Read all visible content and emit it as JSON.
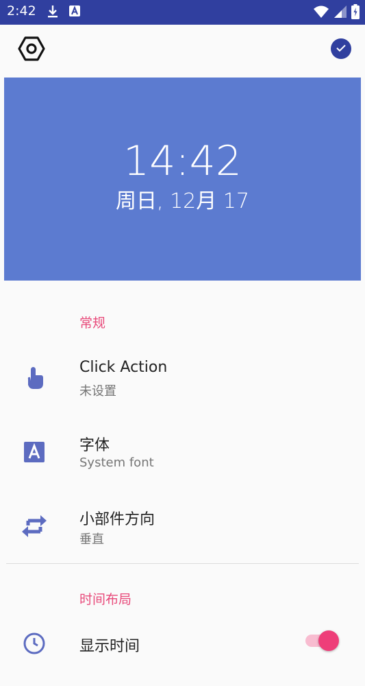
{
  "status_bar": {
    "time": "2:42",
    "left_icons": [
      "download-icon",
      "font-app-icon"
    ],
    "right_icons": [
      "wifi-icon",
      "signal-icon",
      "battery-icon"
    ],
    "bg_color": "#303f9f"
  },
  "toolbar": {
    "settings_icon": "settings-hexagon-icon",
    "confirm_icon": "check-circle-icon"
  },
  "preview": {
    "time": "14:42",
    "date": "周日, 12月 17",
    "bg_color": "#5c7bd0"
  },
  "sections": {
    "general": {
      "header": "常规",
      "items": [
        {
          "title": "Click Action",
          "summary": "未设置",
          "icon": "touch-icon"
        },
        {
          "title": "字体",
          "summary": "System font",
          "icon": "font-icon"
        },
        {
          "title": "小部件方向",
          "summary": "垂直",
          "icon": "swap-arrows-icon"
        }
      ]
    },
    "time_layout": {
      "header": "时间布局",
      "items": [
        {
          "title": "显示时间",
          "icon": "clock-icon",
          "toggle_on": true
        }
      ]
    }
  },
  "colors": {
    "accent": "#e8497a",
    "icon": "#5c6bc0"
  }
}
